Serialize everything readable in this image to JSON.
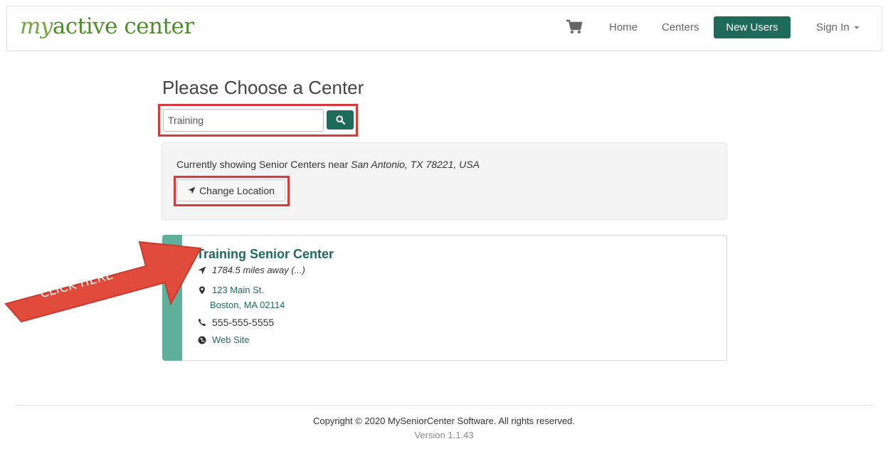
{
  "brand": {
    "my": "my",
    "rest": "active center"
  },
  "nav": {
    "home": "Home",
    "centers": "Centers",
    "new_users": "New Users",
    "sign_in": "Sign In"
  },
  "page": {
    "title": "Please Choose a Center"
  },
  "search": {
    "value": "Training"
  },
  "location": {
    "prefix": "Currently showing Senior Centers near ",
    "place": "San Antonio, TX 78221, USA",
    "change_label": "Change Location"
  },
  "center": {
    "name": "Training Senior Center",
    "distance": "1784.5 miles away (...)",
    "address_line1": "123 Main St.",
    "address_line2": "Boston, MA 02114",
    "phone": "555-555-5555",
    "website": "Web Site"
  },
  "overlay": {
    "arrow_label": "CLICK HERE"
  },
  "footer": {
    "copyright": "Copyright © 2020 MySeniorCenter Software. All rights reserved.",
    "version": "Version 1.1.43"
  },
  "colors": {
    "brand_green": "#4e8d2a",
    "primary": "#1e6b5c",
    "card_accent": "#5fb09b",
    "highlight_red": "#d63a3a"
  }
}
